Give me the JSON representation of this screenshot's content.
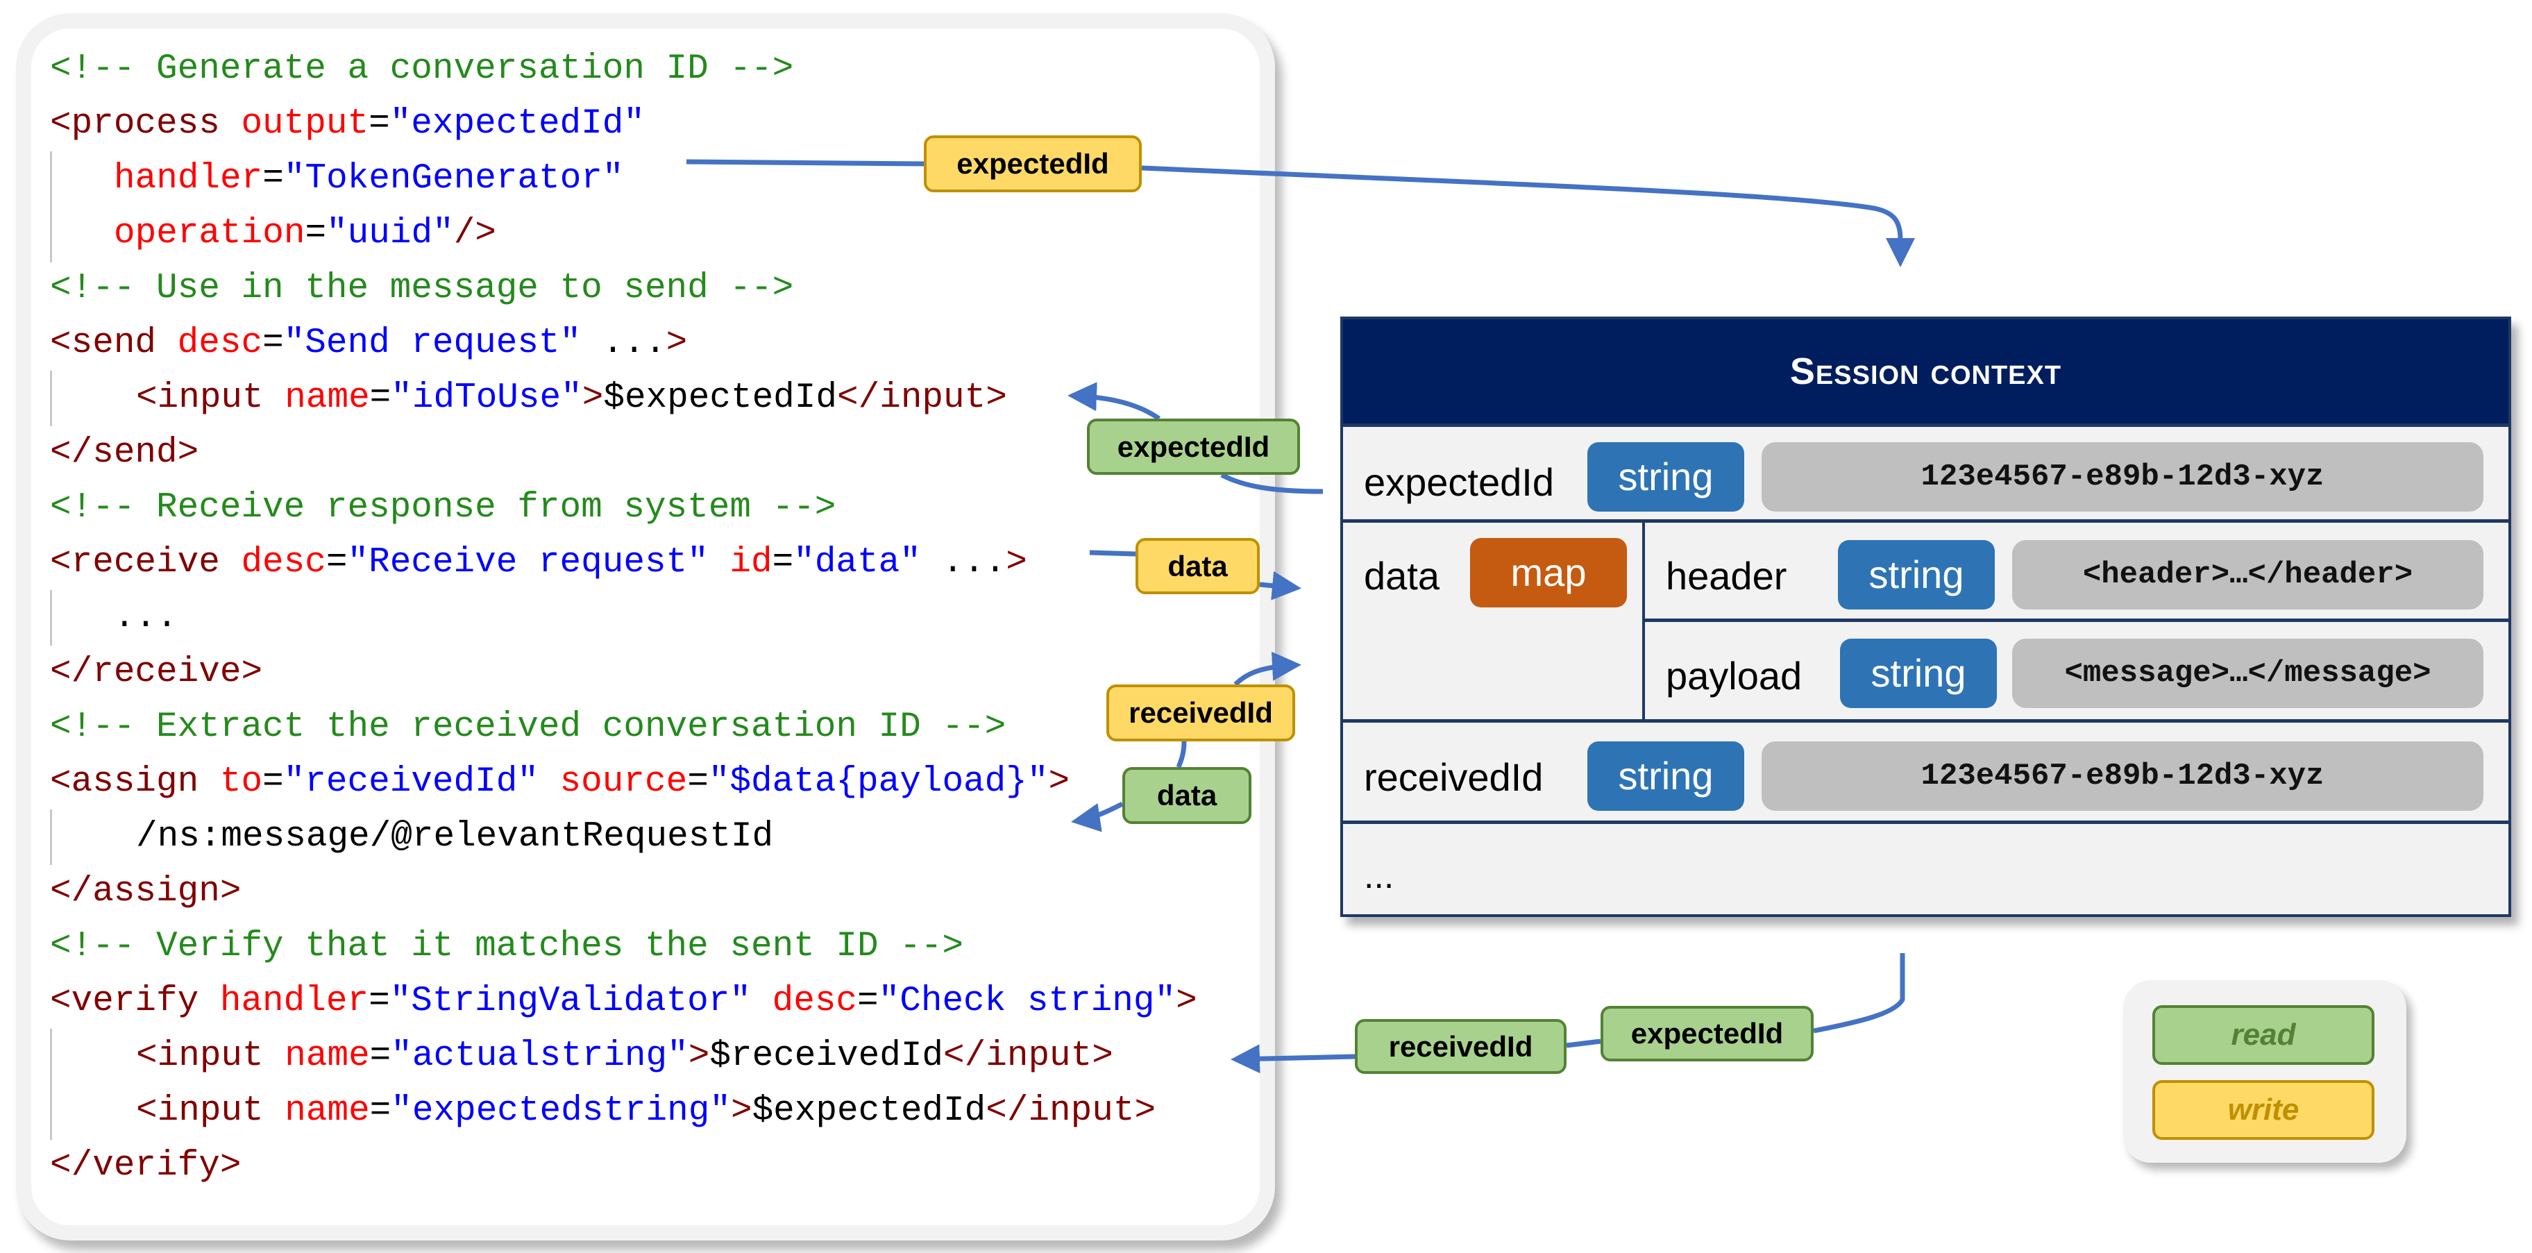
{
  "code": {
    "lines": [
      {
        "parts": [
          {
            "t": "comment",
            "v": "<!-- Generate a conversation ID -->"
          }
        ]
      },
      {
        "parts": [
          {
            "t": "tag",
            "v": "<process "
          },
          {
            "t": "attr",
            "v": "output"
          },
          {
            "t": "eq",
            "v": "="
          },
          {
            "t": "val",
            "v": "\"expectedId\""
          }
        ]
      },
      {
        "parts": [
          {
            "t": "attr",
            "v": "handler"
          },
          {
            "t": "eq",
            "v": "="
          },
          {
            "t": "val",
            "v": "\"TokenGenerator\""
          }
        ]
      },
      {
        "parts": [
          {
            "t": "attr",
            "v": "operation"
          },
          {
            "t": "eq",
            "v": "="
          },
          {
            "t": "val",
            "v": "\"uuid\""
          },
          {
            "t": "tag",
            "v": "/>"
          }
        ]
      },
      {
        "parts": [
          {
            "t": "comment",
            "v": "<!-- Use in the message to send -->"
          }
        ]
      },
      {
        "parts": [
          {
            "t": "tag",
            "v": "<send "
          },
          {
            "t": "attr",
            "v": "desc"
          },
          {
            "t": "eq",
            "v": "="
          },
          {
            "t": "val",
            "v": "\"Send request\""
          },
          {
            "t": "text",
            "v": " ..."
          },
          {
            "t": "tag",
            "v": ">"
          }
        ]
      },
      {
        "parts": [
          {
            "t": "tag",
            "v": "<input "
          },
          {
            "t": "attr",
            "v": "name"
          },
          {
            "t": "eq",
            "v": "="
          },
          {
            "t": "val",
            "v": "\"idToUse\""
          },
          {
            "t": "tag",
            "v": ">"
          },
          {
            "t": "text",
            "v": "$expectedId"
          },
          {
            "t": "tag",
            "v": "</input>"
          }
        ]
      },
      {
        "parts": [
          {
            "t": "tag",
            "v": "</send>"
          }
        ]
      },
      {
        "parts": [
          {
            "t": "comment",
            "v": "<!-- Receive response from system -->"
          }
        ]
      },
      {
        "parts": [
          {
            "t": "tag",
            "v": "<receive "
          },
          {
            "t": "attr",
            "v": "desc"
          },
          {
            "t": "eq",
            "v": "="
          },
          {
            "t": "val",
            "v": "\"Receive request\""
          },
          {
            "t": "text",
            "v": " "
          },
          {
            "t": "attr",
            "v": "id"
          },
          {
            "t": "eq",
            "v": "="
          },
          {
            "t": "val",
            "v": "\"data\""
          },
          {
            "t": "text",
            "v": " ..."
          },
          {
            "t": "tag",
            "v": ">"
          }
        ]
      },
      {
        "parts": [
          {
            "t": "text",
            "v": "..."
          }
        ]
      },
      {
        "parts": [
          {
            "t": "tag",
            "v": "</receive>"
          }
        ]
      },
      {
        "parts": [
          {
            "t": "comment",
            "v": "<!-- Extract the received conversation ID -->"
          }
        ]
      },
      {
        "parts": [
          {
            "t": "tag",
            "v": "<assign "
          },
          {
            "t": "attr",
            "v": "to"
          },
          {
            "t": "eq",
            "v": "="
          },
          {
            "t": "val",
            "v": "\"receivedId\""
          },
          {
            "t": "text",
            "v": " "
          },
          {
            "t": "attr",
            "v": "source"
          },
          {
            "t": "eq",
            "v": "="
          },
          {
            "t": "val",
            "v": "\"$data{payload}\""
          },
          {
            "t": "tag",
            "v": ">"
          }
        ]
      },
      {
        "parts": [
          {
            "t": "text",
            "v": "/ns:message/@relevantRequestId"
          }
        ]
      },
      {
        "parts": [
          {
            "t": "tag",
            "v": "</assign>"
          }
        ]
      },
      {
        "parts": [
          {
            "t": "comment",
            "v": "<!-- Verify that it matches the sent ID -->"
          }
        ]
      },
      {
        "parts": [
          {
            "t": "tag",
            "v": "<verify "
          },
          {
            "t": "attr",
            "v": "handler"
          },
          {
            "t": "eq",
            "v": "="
          },
          {
            "t": "val",
            "v": "\"StringValidator\""
          },
          {
            "t": "text",
            "v": " "
          },
          {
            "t": "attr",
            "v": "desc"
          },
          {
            "t": "eq",
            "v": "="
          },
          {
            "t": "val",
            "v": "\"Check string\""
          },
          {
            "t": "tag",
            "v": ">"
          }
        ]
      },
      {
        "parts": [
          {
            "t": "tag",
            "v": "<input "
          },
          {
            "t": "attr",
            "v": "name"
          },
          {
            "t": "eq",
            "v": "="
          },
          {
            "t": "val",
            "v": "\"actualstring\""
          },
          {
            "t": "tag",
            "v": ">"
          },
          {
            "t": "text",
            "v": "$receivedId"
          },
          {
            "t": "tag",
            "v": "</input>"
          }
        ]
      },
      {
        "parts": [
          {
            "t": "tag",
            "v": "<input "
          },
          {
            "t": "attr",
            "v": "name"
          },
          {
            "t": "eq",
            "v": "="
          },
          {
            "t": "val",
            "v": "\"expectedstring\""
          },
          {
            "t": "tag",
            "v": ">"
          },
          {
            "t": "text",
            "v": "$expectedId"
          },
          {
            "t": "tag",
            "v": "</input>"
          }
        ]
      },
      {
        "parts": [
          {
            "t": "tag",
            "v": "</verify>"
          }
        ]
      }
    ]
  },
  "session": {
    "title": "Session context",
    "rows": {
      "expectedId": {
        "name": "expectedId",
        "type": "string",
        "value": "123e4567-e89b-12d3-xyz"
      },
      "data": {
        "name": "data",
        "type": "map",
        "entries": [
          {
            "name": "header",
            "type": "string",
            "value": "<header>…</header>"
          },
          {
            "name": "payload",
            "type": "string",
            "value": "<message>…</message>"
          }
        ]
      },
      "receivedId": {
        "name": "receivedId",
        "type": "string",
        "value": "123e4567-e89b-12d3-xyz"
      },
      "more": "..."
    }
  },
  "flow_tags": {
    "process_write_expectedId": "expectedId",
    "send_read_expectedId": "expectedId",
    "receive_write_data": "data",
    "assign_write_receivedId": "receivedId",
    "assign_read_data": "data",
    "verify_read_receivedId": "receivedId",
    "verify_read_expectedId": "expectedId"
  },
  "legend": {
    "read": "read",
    "write": "write"
  },
  "colors": {
    "comment": "#248a1c",
    "tag": "#800000",
    "attribute": "#ff0000",
    "value": "#0000ff",
    "session_header": "#001e5e",
    "string_badge": "#2e74b5",
    "map_badge": "#c55a11",
    "read_tag": "#a9d18e",
    "write_tag": "#ffd966",
    "arrow": "#4472c4"
  }
}
